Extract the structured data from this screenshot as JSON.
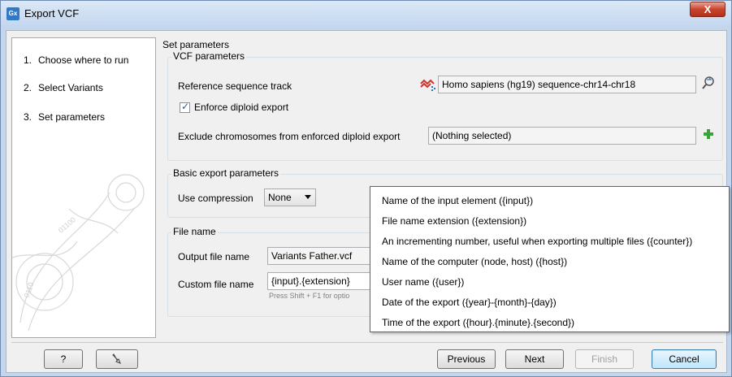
{
  "window": {
    "title": "Export VCF",
    "app_icon": "Gx",
    "close_glyph": "X"
  },
  "steps": [
    {
      "num": "1.",
      "label": "Choose where to run"
    },
    {
      "num": "2.",
      "label": "Select Variants"
    },
    {
      "num": "3.",
      "label": "Set parameters"
    }
  ],
  "header": "Set parameters",
  "vcf_params": {
    "title": "VCF parameters",
    "reference_label": "Reference sequence track",
    "reference_value": "Homo sapiens (hg19) sequence-chr14-chr18",
    "diploid_label": "Enforce diploid export",
    "diploid_checked": true,
    "exclude_label": "Exclude chromosomes from enforced diploid export",
    "exclude_value": "(Nothing selected)"
  },
  "basic_params": {
    "title": "Basic export parameters",
    "compression_label": "Use compression",
    "compression_value": "None"
  },
  "file_name": {
    "title": "File name",
    "output_label": "Output file name",
    "output_value": "Variants Father.vcf",
    "custom_label": "Custom file name",
    "custom_value": "{input}.{extension}",
    "hint": "Press Shift + F1 for optio"
  },
  "popup": [
    "Name of the input element ({input})",
    "File name extension ({extension})",
    "An incrementing number, useful when exporting multiple files ({counter})",
    "Name of the computer (node, host) ({host})",
    "User name ({user})",
    "Date of the export ({year}-{month}-{day})",
    "Time of the export ({hour}.{minute}.{second})"
  ],
  "buttons": {
    "help": "?",
    "previous": "Previous",
    "next": "Next",
    "finish": "Finish",
    "cancel": "Cancel"
  },
  "icons": {
    "reference_icon": "sequence-track-icon",
    "browse_icon": "browse-icon",
    "add_icon": "add-icon",
    "reset_icon": "reset-icon"
  },
  "colors": {
    "accent": "#2f79c8",
    "close": "#c7442c",
    "add": "#3aa23a"
  }
}
